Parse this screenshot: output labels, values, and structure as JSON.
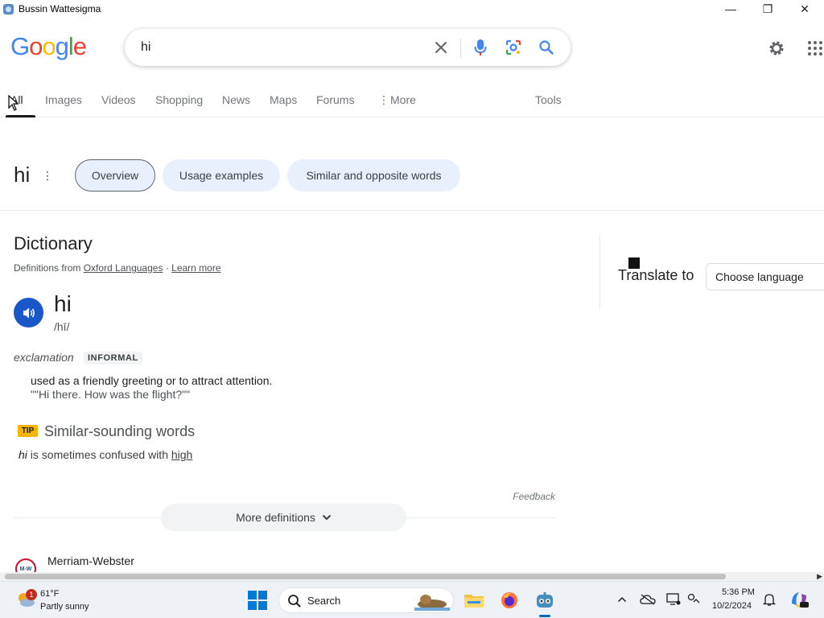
{
  "window": {
    "title": "Bussin Wattesigma",
    "minimize_glyph": "—",
    "maximize_glyph": "❐",
    "close_glyph": "✕"
  },
  "header": {
    "logo_letters": [
      {
        "char": "G",
        "color": "#4285f4"
      },
      {
        "char": "o",
        "color": "#ea4335"
      },
      {
        "char": "o",
        "color": "#fbbc05"
      },
      {
        "char": "g",
        "color": "#4285f4"
      },
      {
        "char": "l",
        "color": "#34a853"
      },
      {
        "char": "e",
        "color": "#ea4335"
      }
    ],
    "search_value": "hi",
    "icons": [
      "clear-icon",
      "microphone-icon",
      "lens-icon",
      "search-icon",
      "settings-icon",
      "apps-icon"
    ]
  },
  "tabs": {
    "items": [
      {
        "label": "All",
        "active": true
      },
      {
        "label": "Images"
      },
      {
        "label": "Videos"
      },
      {
        "label": "Shopping"
      },
      {
        "label": "News"
      },
      {
        "label": "Maps"
      },
      {
        "label": "Forums"
      },
      {
        "label": "More"
      }
    ],
    "more_glyph": "⋮",
    "tools": "Tools"
  },
  "word_row": {
    "word": "hi",
    "kebab": "⋮",
    "chips": [
      "Overview",
      "Usage examples",
      "Similar and opposite words"
    ]
  },
  "dictionary": {
    "heading": "Dictionary",
    "source_prefix": "Definitions from",
    "source_name": "Oxford Languages",
    "source_sep": "·",
    "learn_more": "Learn more",
    "headword": "hi",
    "pronunciation": "/hī/",
    "part_of_speech": "exclamation",
    "register": "INFORMAL",
    "definition": "used as a friendly greeting or to attract attention.",
    "example": "\"\"Hi there. How was the flight?\"\"",
    "tip_badge": "TIP",
    "tip_heading": "Similar-sounding words",
    "tip_word": "hi",
    "tip_middle": "is sometimes confused with",
    "tip_link": "high",
    "feedback": "Feedback",
    "more_definitions": "More definitions",
    "next_source": "Merriam-Webster",
    "next_source_logo": "M-W"
  },
  "translate": {
    "label": "Translate to",
    "select_value": "Choose language"
  },
  "taskbar": {
    "weather_temp": "61°F",
    "weather_desc": "Partly sunny",
    "weather_badge": "1",
    "search_label": "Search",
    "clock_time": "5:36 PM",
    "clock_date": "10/2/2024",
    "tray_icons": [
      "chevron-up-icon",
      "onedrive-offline-icon",
      "display-icon",
      "accessibility-icon",
      "notification-bell-icon",
      "copilot-icon"
    ],
    "apps": [
      "file-explorer-icon",
      "firefox-icon",
      "godot-engine-icon"
    ]
  },
  "colors": {
    "accent": "#1a73e8",
    "chip_bg": "#e8f0fe",
    "speaker_bg": "#1a57c8",
    "tip_badge_bg": "#f4b400"
  }
}
